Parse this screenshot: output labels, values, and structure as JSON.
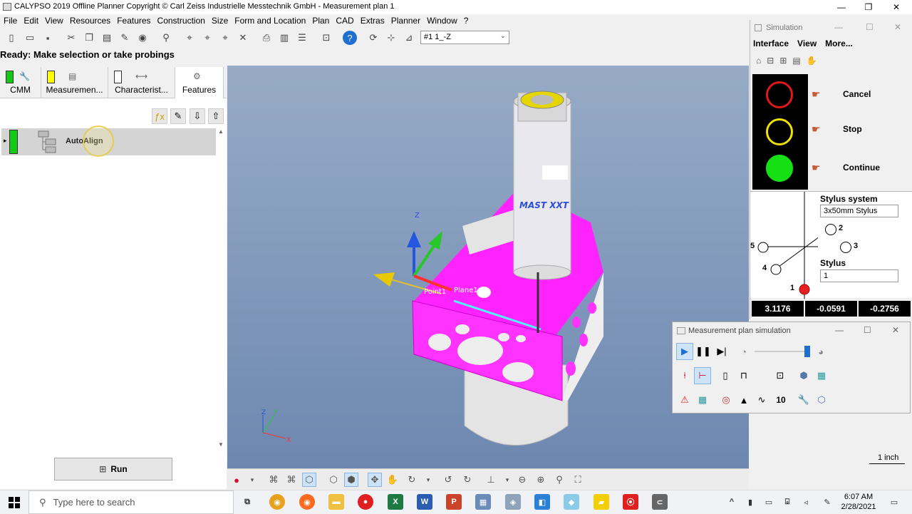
{
  "window": {
    "title": "CALYPSO 2019 Offline Planner Copyright © Carl Zeiss Industrielle Messtechnik GmbH - Measurement plan 1"
  },
  "menu": [
    "File",
    "Edit",
    "View",
    "Resources",
    "Features",
    "Construction",
    "Size",
    "Form and Location",
    "Plan",
    "CAD",
    "Extras",
    "Planner",
    "Window",
    "?"
  ],
  "view_select": {
    "value": "#1    1_-Z"
  },
  "status": "Ready: Make selection or take probings",
  "tabs": [
    {
      "label": "CMM",
      "flag_color": "#14c814"
    },
    {
      "label": "Measuremen...",
      "flag_color": "#ffff00"
    },
    {
      "label": "Characterist...",
      "flag_color": "#ffffff"
    },
    {
      "label": "Features"
    }
  ],
  "tree": {
    "items": [
      {
        "label": "AutoAlign"
      }
    ]
  },
  "run_button": "Run",
  "viewport": {
    "axis_label_z": "Z",
    "label_point": "Point1",
    "label_plane": "Plane1",
    "small_axes": {
      "z": "Z",
      "y": "Y",
      "x": "X"
    },
    "probe_text": "MAST  XXT",
    "unit_label": "1 inch"
  },
  "simulation": {
    "title": "Simulation",
    "menu": [
      "Interface",
      "View",
      "More..."
    ],
    "buttons": [
      "Cancel",
      "Stop",
      "Continue"
    ],
    "stylus_system_label": "Stylus system",
    "stylus_system_value": "3x50mm Stylus",
    "stylus_label": "Stylus",
    "stylus_value": "1",
    "stylus_numbers": [
      "2",
      "3",
      "5",
      "4",
      "1"
    ],
    "coords": [
      "3.1176",
      "-0.0591",
      "-0.2756"
    ]
  },
  "mp_simulation": {
    "title": "Measurement plan simulation",
    "count": "10"
  },
  "taskbar": {
    "search_placeholder": "Type here to search",
    "time": "6:07 AM",
    "date": "2/28/2021"
  }
}
